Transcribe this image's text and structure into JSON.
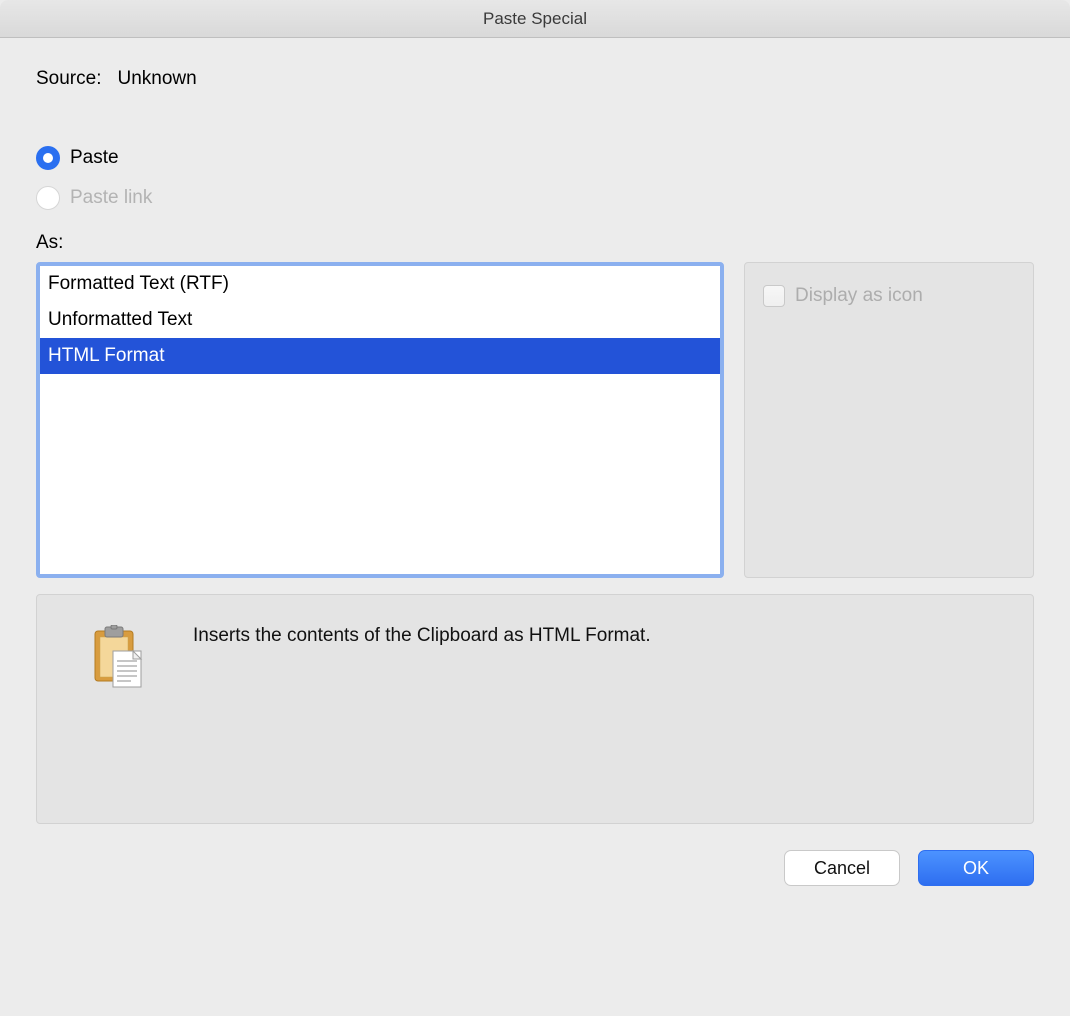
{
  "title": "Paste Special",
  "source": {
    "label": "Source:",
    "value": "Unknown"
  },
  "radio": {
    "paste_label": "Paste",
    "paste_link_label": "Paste link",
    "paste_selected": true,
    "paste_link_enabled": false
  },
  "as_label": "As:",
  "formats": {
    "items": [
      {
        "label": "Formatted Text (RTF)",
        "selected": false
      },
      {
        "label": "Unformatted Text",
        "selected": false
      },
      {
        "label": "HTML Format",
        "selected": true
      }
    ]
  },
  "display_as_icon": {
    "label": "Display as icon",
    "checked": false,
    "enabled": false
  },
  "description": "Inserts the contents of the Clipboard as HTML Format.",
  "buttons": {
    "cancel": "Cancel",
    "ok": "OK"
  }
}
